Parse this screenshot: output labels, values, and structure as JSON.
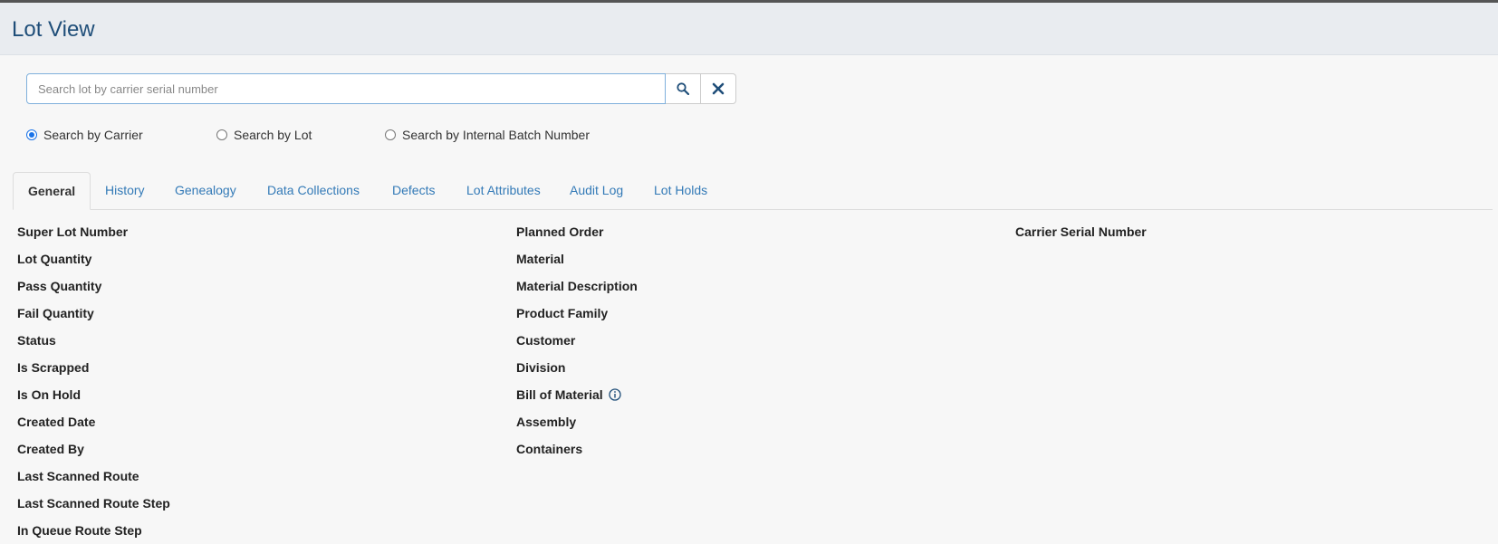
{
  "header": {
    "title": "Lot View"
  },
  "search": {
    "placeholder": "Search lot by carrier serial number",
    "value": ""
  },
  "search_modes": [
    {
      "label": "Search by Carrier",
      "selected": true
    },
    {
      "label": "Search by Lot",
      "selected": false
    },
    {
      "label": "Search by Internal Batch Number",
      "selected": false
    }
  ],
  "tabs": [
    {
      "label": "General",
      "active": true
    },
    {
      "label": "History",
      "active": false
    },
    {
      "label": "Genealogy",
      "active": false
    },
    {
      "label": "Data Collections",
      "active": false
    },
    {
      "label": "Defects",
      "active": false
    },
    {
      "label": "Lot Attributes",
      "active": false
    },
    {
      "label": "Audit Log",
      "active": false
    },
    {
      "label": "Lot Holds",
      "active": false
    }
  ],
  "general": {
    "column1": [
      "Super Lot Number",
      "Lot Quantity",
      "Pass Quantity",
      "Fail Quantity",
      "Status",
      "Is Scrapped",
      "Is On Hold",
      "Created Date",
      "Created By",
      "Last Scanned Route",
      "Last Scanned Route Step",
      "In Queue Route Step"
    ],
    "column2": [
      "Planned Order",
      "Material",
      "Material Description",
      "Product Family",
      "Customer",
      "Division",
      "Bill of Material",
      "Assembly",
      "Containers"
    ],
    "column3": [
      "Carrier Serial Number"
    ]
  },
  "icons": {
    "search": "search-icon",
    "clear": "close-icon",
    "info": "info-icon"
  },
  "colors": {
    "title": "#1f4e79",
    "link": "#337ab7",
    "radio_selected": "#1a73e8",
    "header_bg": "#e9ecf0"
  }
}
